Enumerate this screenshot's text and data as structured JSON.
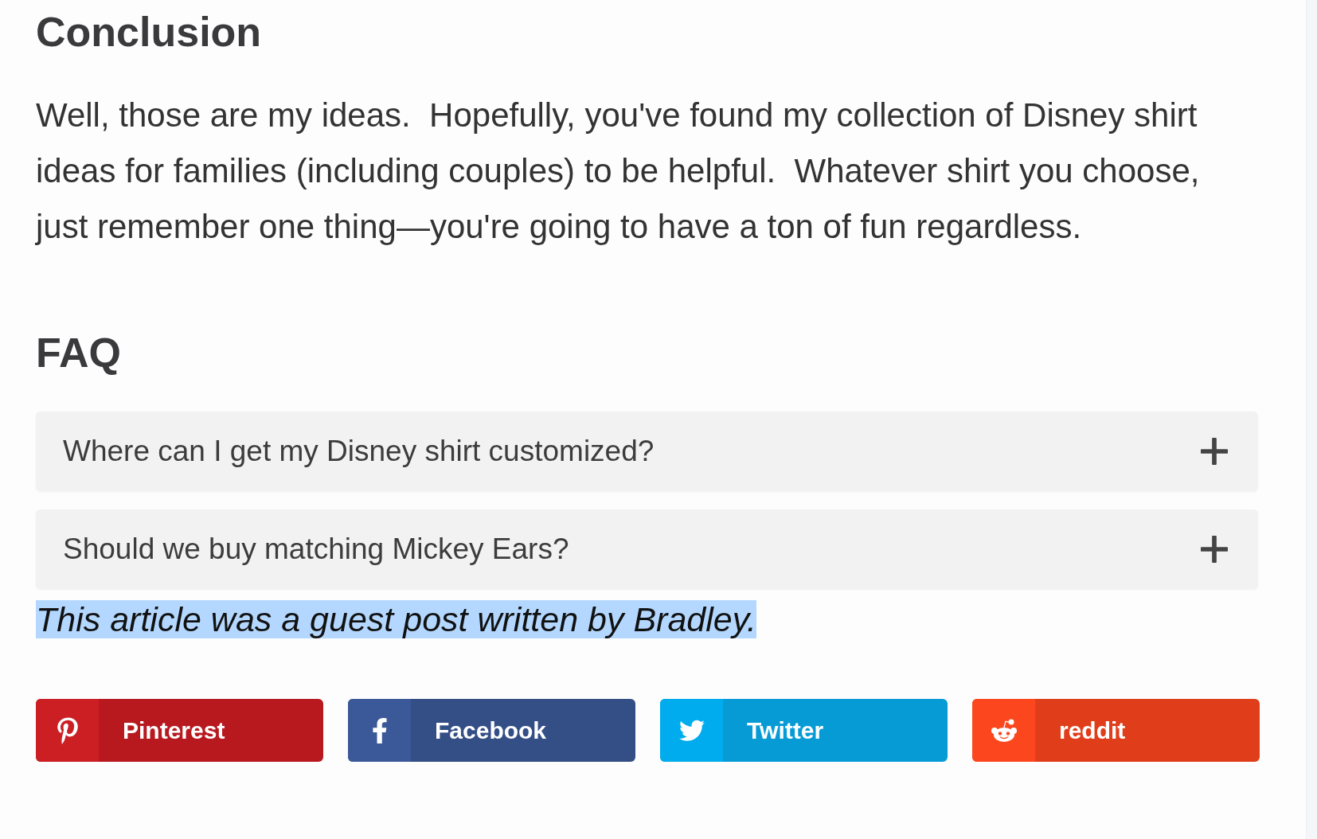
{
  "conclusion": {
    "heading": "Conclusion",
    "paragraph": "Well, those are my ideas.  Hopefully, you've found my collection of Disney shirt ideas for families (including couples) to be helpful.  Whatever shirt you choose, just remember one thing—you're going to have a ton of fun regardless."
  },
  "faq": {
    "heading": "FAQ",
    "items": [
      {
        "question": "Where can I get my Disney shirt customized?",
        "expanded": false
      },
      {
        "question": "Should we buy matching Mickey Ears?",
        "expanded": false
      }
    ]
  },
  "guest_note": {
    "text": "This article was a guest post written by Bradley.",
    "selected": true
  },
  "share_buttons": [
    {
      "kind": "pinterest",
      "label": "Pinterest",
      "color": "#b7191f"
    },
    {
      "kind": "facebook",
      "label": "Facebook",
      "color": "#344e86"
    },
    {
      "kind": "twitter",
      "label": "Twitter",
      "color": "#079bd6"
    },
    {
      "kind": "reddit",
      "label": "reddit",
      "color": "#e03e1b"
    }
  ]
}
